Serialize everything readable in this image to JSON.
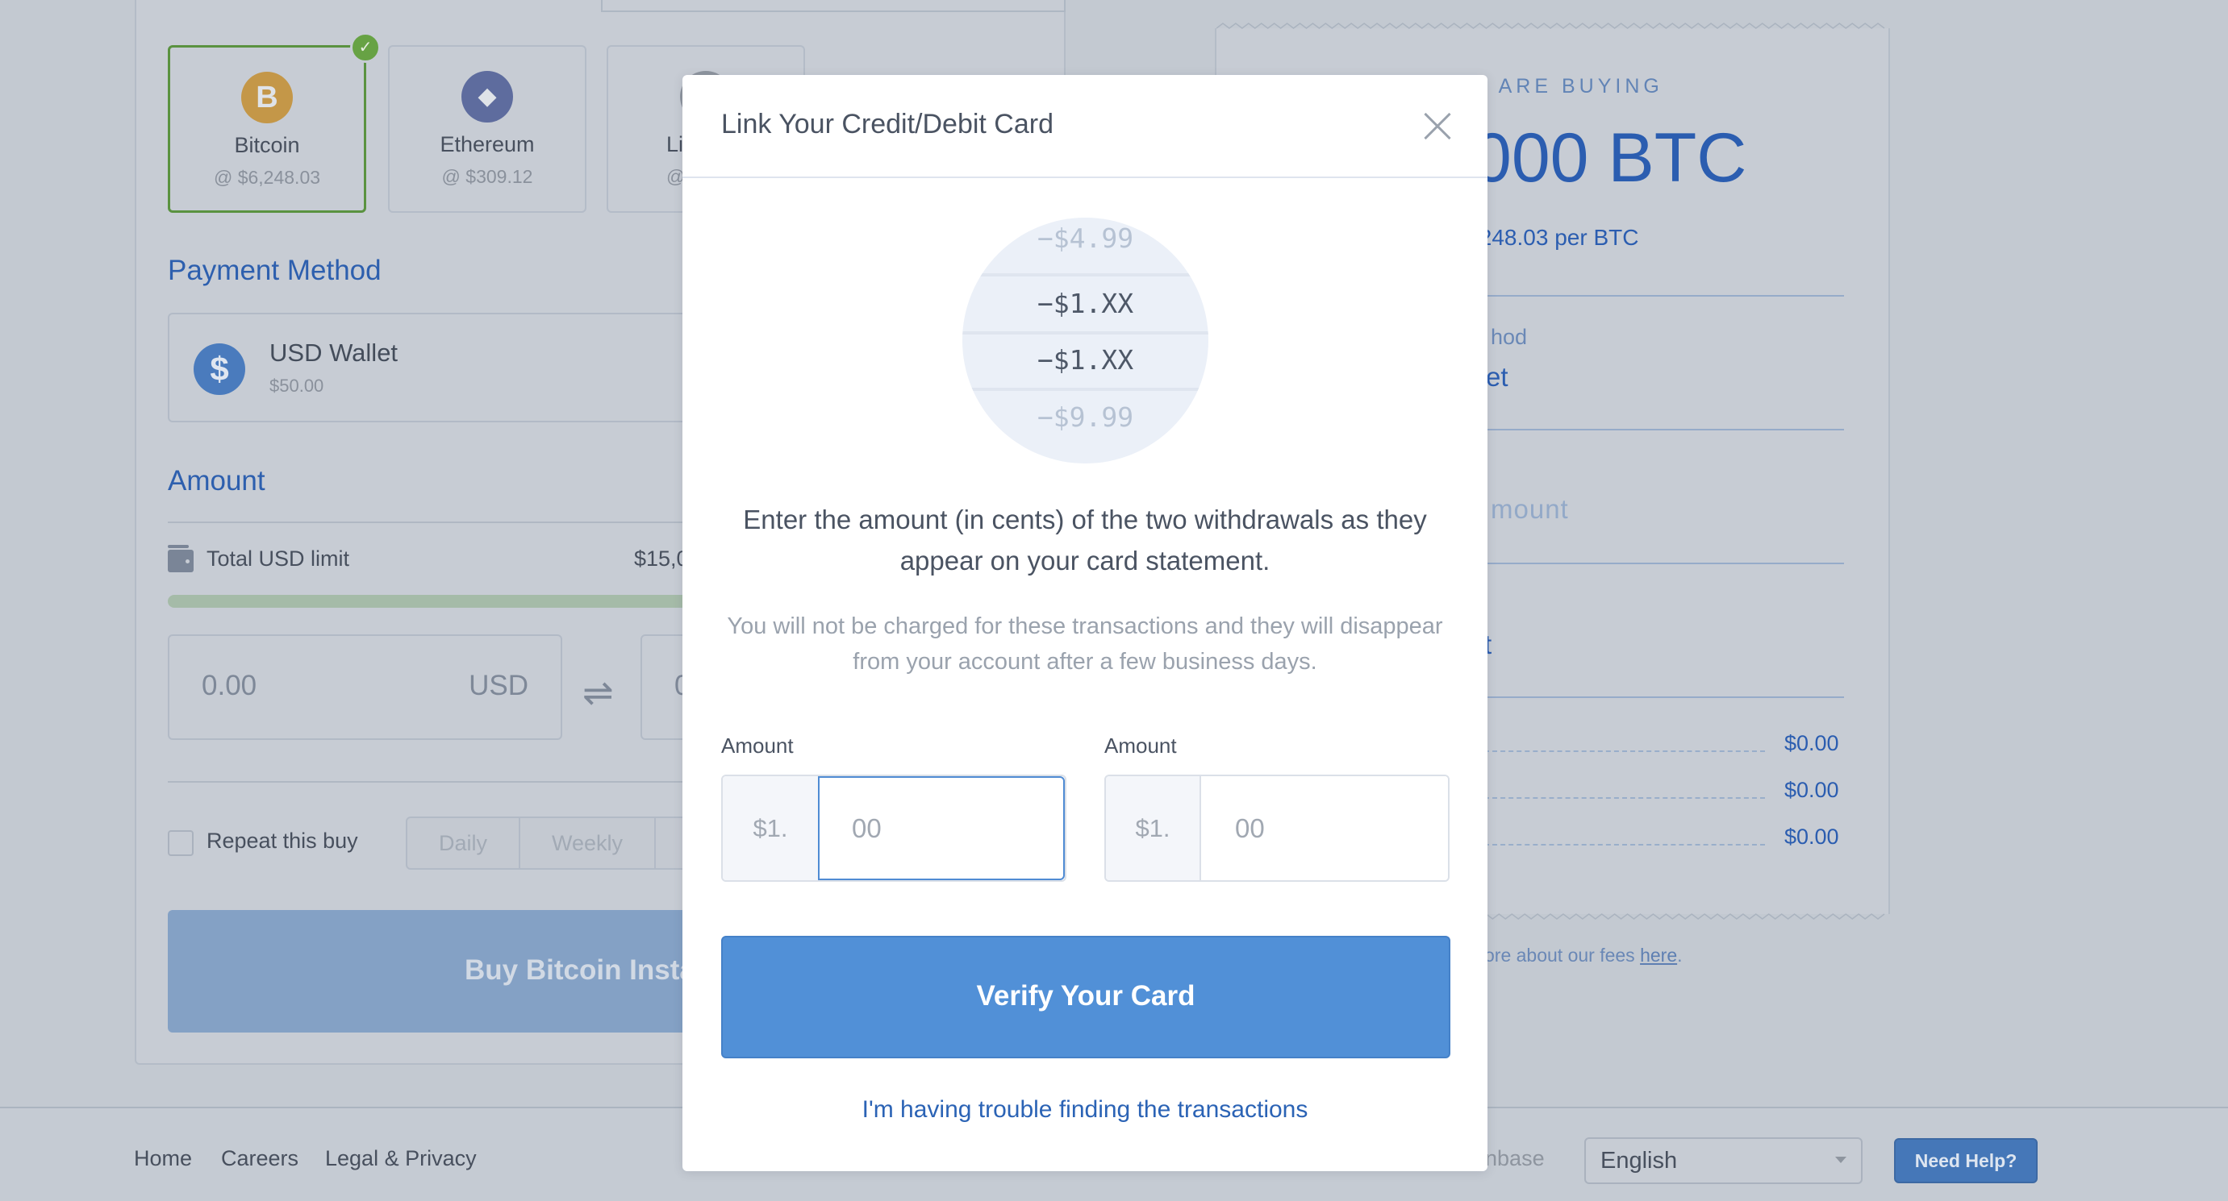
{
  "coins": [
    {
      "name": "Bitcoin",
      "price": "@ $6,248.03",
      "icon": "bitcoin-icon",
      "glyph": "B",
      "color": "#c49748",
      "selected": true
    },
    {
      "name": "Ethereum",
      "price": "@ $309.12",
      "icon": "ethereum-icon",
      "glyph": "◆",
      "color": "#5e6c9e",
      "selected": false
    },
    {
      "name": "Li",
      "price": "@",
      "icon": "litecoin-icon",
      "glyph": "",
      "color": "#8e959f",
      "selected": false
    }
  ],
  "payment": {
    "heading": "Payment Method",
    "method_name": "USD Wallet",
    "method_balance": "$50.00",
    "icon_glyph": "$"
  },
  "amount": {
    "heading": "Amount",
    "limit_label": "Total USD limit",
    "limit_value": "$15,0",
    "limit_progress_fraction": 1.0,
    "usd_value": "0.00",
    "usd_currency": "USD",
    "swap_glyph": "⇌",
    "btc_value_partial": "0"
  },
  "repeat": {
    "label": "Repeat this buy",
    "checked": false,
    "options": [
      "Daily",
      "Weekly",
      ""
    ]
  },
  "buy_button_label": "Buy Bitcoin Insta",
  "receipt": {
    "buying_label": "U ARE BUYING",
    "amount": "000 BTC",
    "rate": ",248.03 per BTC",
    "method_label": "hod",
    "method_value": "et",
    "amount_label": "mount",
    "total_partial": "t",
    "fee_lines": [
      "$0.00",
      "$0.00",
      "$0.00"
    ],
    "fees_note_prefix": "ore about our fees ",
    "fees_link": "here",
    "fees_note_suffix": "."
  },
  "footer": {
    "links": [
      "Home",
      "Careers",
      "Legal & Privacy"
    ],
    "brand_partial": "oinbase",
    "language": "English",
    "help_button": "Need Help?"
  },
  "modal": {
    "title": "Link Your Credit/Debit Card",
    "statement_rows": [
      {
        "text": "−$4.99",
        "style": "faint"
      },
      {
        "text": "−$1.XX",
        "style": "dark"
      },
      {
        "text": "−$1.XX",
        "style": "dark"
      },
      {
        "text": "−$9.99",
        "style": "faint"
      }
    ],
    "instructions": "Enter the amount (in cents) of the two withdrawals as they appear on your card statement.",
    "subtext": "You will not be charged for these transactions and they will disappear from your account after a few business days.",
    "fields": [
      {
        "label": "Amount",
        "prefix": "$1.",
        "placeholder": "00",
        "value": "",
        "focused": true
      },
      {
        "label": "Amount",
        "prefix": "$1.",
        "placeholder": "00",
        "value": "",
        "focused": false
      }
    ],
    "verify_button": "Verify Your Card",
    "trouble_link": "I'm having trouble finding the transactions"
  },
  "colors": {
    "accent": "#5190d7",
    "link": "#2b63b5",
    "selected_border": "#5a9240",
    "check_badge": "#67a244"
  }
}
